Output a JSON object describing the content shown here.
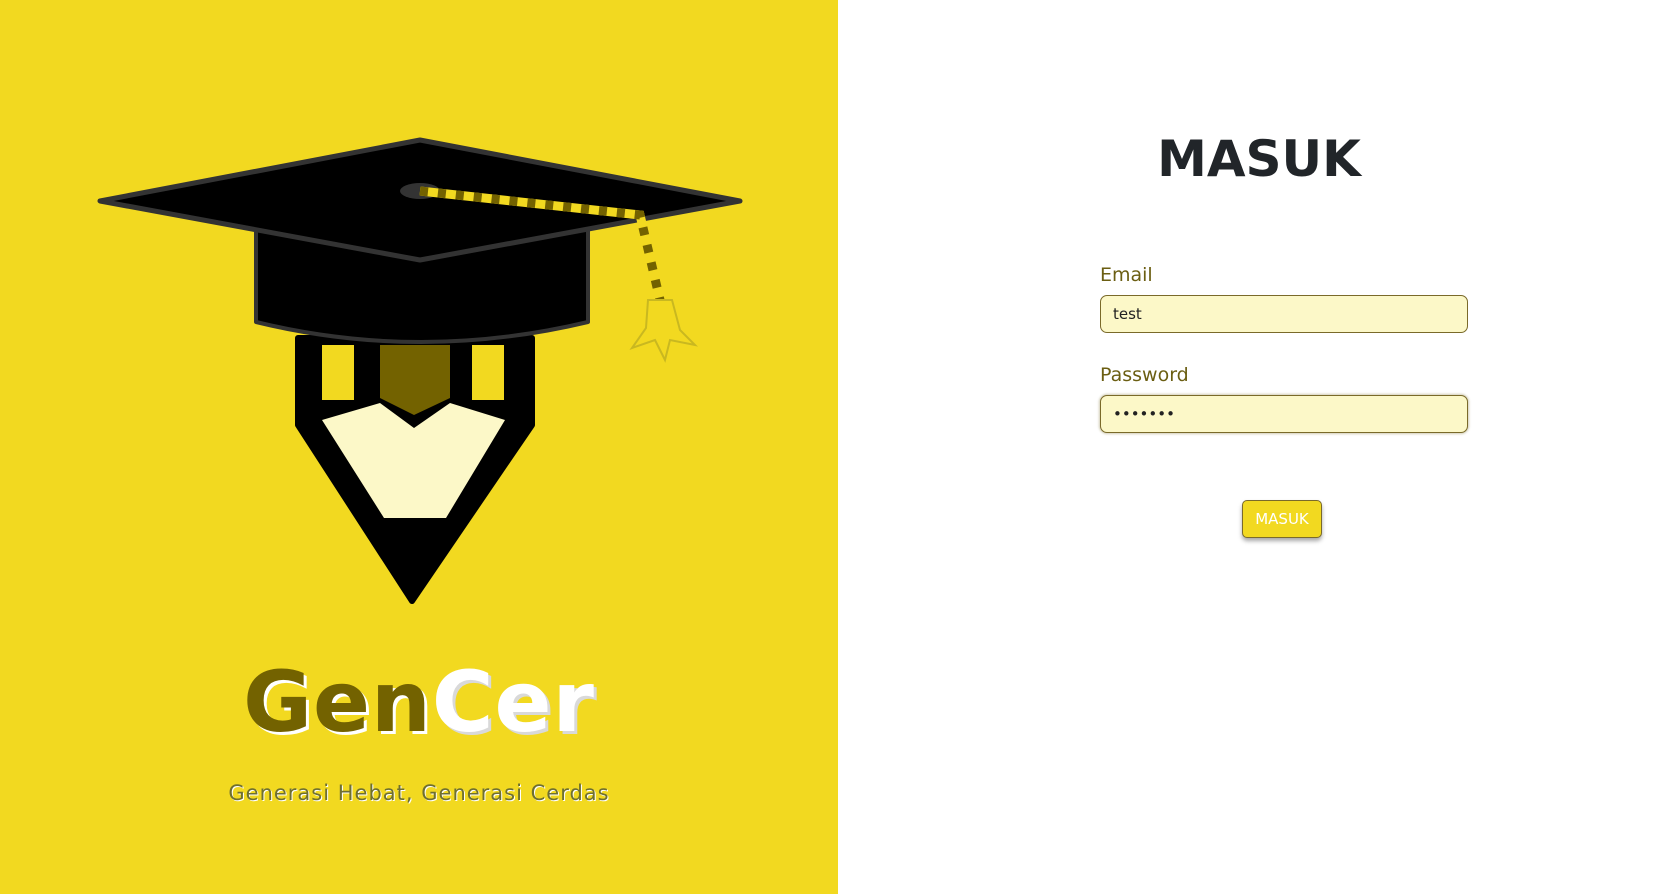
{
  "brand": {
    "name_part1": "Gen",
    "name_part2": "Cer",
    "tagline": "Generasi Hebat,  Generasi Cerdas",
    "logo_icon": "graduation-cap-pencil-icon"
  },
  "login": {
    "title": "MASUK",
    "email_label": "Email",
    "email_value": "test",
    "password_label": "Password",
    "password_value": "•••••••",
    "submit_label": "MASUK"
  },
  "colors": {
    "brand_yellow": "#f2d920",
    "brand_dark": "#736200",
    "input_bg": "#fcf8c8",
    "title_color": "#212529"
  }
}
